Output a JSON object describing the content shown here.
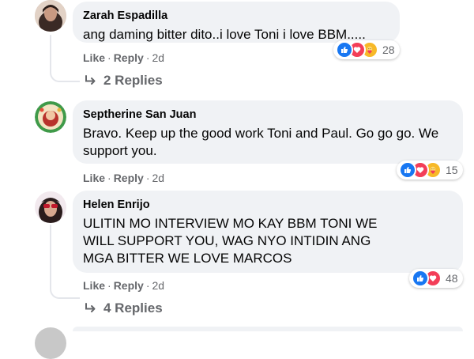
{
  "comments": [
    {
      "name": "Zarah Espadilla",
      "text": "ang daming bitter dito..i love Toni i love BBM.....",
      "actions": {
        "like": "Like",
        "reply": "Reply",
        "time": "2d"
      },
      "reactions": {
        "icons": [
          "like-icon",
          "love-icon",
          "care-icon"
        ],
        "count": "28"
      },
      "replies_label": "2 Replies"
    },
    {
      "name": "Septherine San Juan",
      "text": "Bravo. Keep up the good work Toni and Paul. Go go go. We support you.",
      "actions": {
        "like": "Like",
        "reply": "Reply",
        "time": "2d"
      },
      "reactions": {
        "icons": [
          "like-icon",
          "love-icon",
          "care-icon"
        ],
        "count": "15"
      }
    },
    {
      "name": "Helen Enrijo",
      "text": "ULITIN MO INTERVIEW MO KAY BBM TONI WE WILL SUPPORT YOU, WAG NYO INTIDIN ANG MGA BITTER WE LOVE MARCOS",
      "actions": {
        "like": "Like",
        "reply": "Reply",
        "time": "2d"
      },
      "reactions": {
        "icons": [
          "like-icon",
          "love-icon"
        ],
        "count": "48"
      },
      "replies_label": "4 Replies"
    }
  ],
  "colors": {
    "bubble": "#f0f2f5",
    "secondary_text": "#65676b",
    "like_blue": "#1877f2",
    "love_red": "#f33e58",
    "care_yellow": "#f7b928"
  }
}
